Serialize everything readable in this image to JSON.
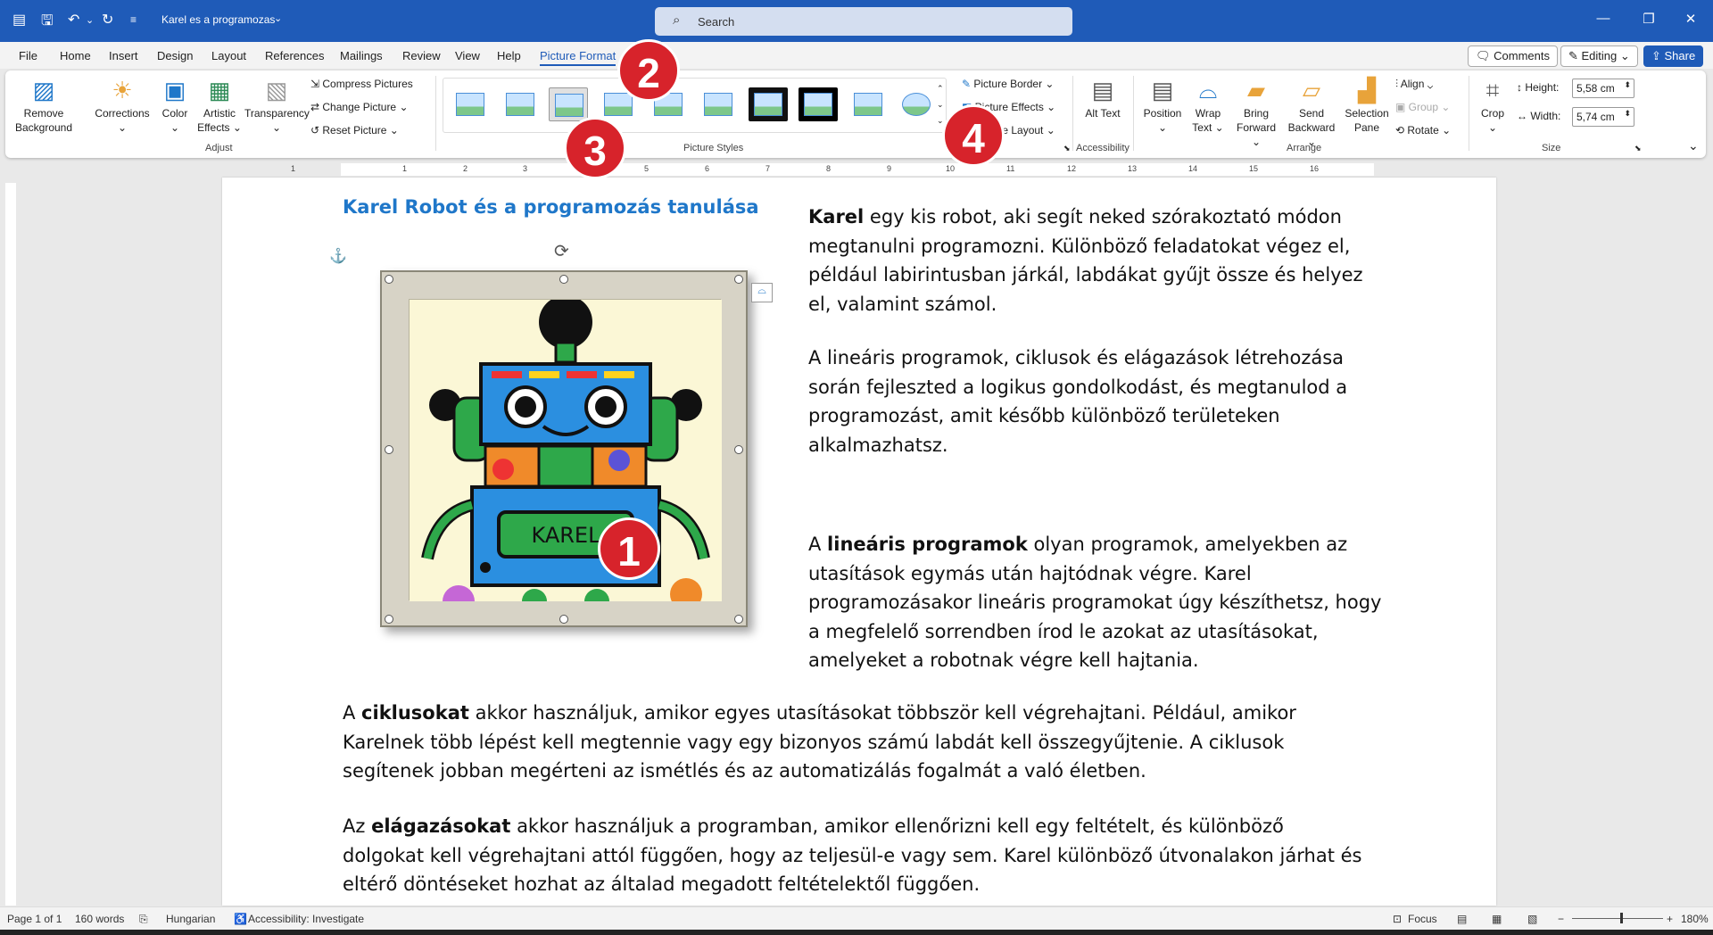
{
  "titlebar": {
    "document_title": "Karel es a programozas",
    "search_placeholder": "Search"
  },
  "tabs": [
    "File",
    "Home",
    "Insert",
    "Design",
    "Layout",
    "References",
    "Mailings",
    "Review",
    "View",
    "Help",
    "Picture Format"
  ],
  "active_tab": "Picture Format",
  "top_buttons": {
    "comments": "Comments",
    "editing": "Editing",
    "share": "Share"
  },
  "ribbon": {
    "adjust": {
      "remove_background": "Remove Background",
      "corrections": "Corrections",
      "color": "Color",
      "artistic_effects": "Artistic Effects",
      "transparency": "Transparency",
      "compress_pictures": "Compress Pictures",
      "change_picture": "Change Picture",
      "reset_picture": "Reset Picture",
      "group_label": "Adjust"
    },
    "picture_styles": {
      "picture_border": "Picture Border",
      "picture_effects": "Picture Effects",
      "picture_layout": "Picture Layout",
      "group_label": "Picture Styles"
    },
    "accessibility": {
      "alt_text": "Alt Text",
      "group_label": "Accessibility"
    },
    "arrange": {
      "position": "Position",
      "wrap_text": "Wrap Text",
      "bring_forward": "Bring Forward",
      "send_backward": "Send Backward",
      "selection_pane": "Selection Pane",
      "align": "Align",
      "group": "Group",
      "rotate": "Rotate",
      "group_label": "Arrange"
    },
    "size": {
      "crop": "Crop",
      "height_label": "Height:",
      "height_value": "5,58 cm",
      "width_label": "Width:",
      "width_value": "5,74 cm",
      "group_label": "Size"
    }
  },
  "ruler_numbers": [
    "1",
    "1",
    "2",
    "3",
    "4",
    "5",
    "6",
    "7",
    "8",
    "9",
    "10",
    "11",
    "12",
    "13",
    "14",
    "15",
    "16"
  ],
  "document": {
    "heading": "Karel Robot és a programozás tanulása",
    "image_label": "KAREL",
    "p1_bold": "Karel",
    "p1_rest": " egy kis robot, aki segít neked szórakoztató módon megtanulni programozni. Különböző feladatokat végez el, például labirintusban járkál, labdákat gyűjt össze és helyez el, valamint számol.",
    "p2": "A lineáris programok, ciklusok és elágazások létrehozása során fejleszted a logikus gondolkodást, és megtanulod a programozást, amit később különböző területeken alkalmazhatsz.",
    "p3_start": "A ",
    "p3_bold": "lineáris programok",
    "p3_rest": " olyan programok, amelyekben az utasítások egymás után hajtódnak végre. Karel programozásakor lineáris programokat úgy készíthetsz, hogy a megfelelő sorrendben írod le azokat az utasításokat, amelyeket a robotnak végre kell hajtania.",
    "p4_start": "A ",
    "p4_bold": "ciklusokat",
    "p4_rest": " akkor használjuk, amikor egyes utasításokat többször kell végrehajtani. Például, amikor Karelnek több lépést kell megtennie vagy egy bizonyos számú labdát kell összegyűjtenie. A ciklusok segítenek jobban megérteni az ismétlés és az automatizálás fogalmát a való életben.",
    "p5_start": "Az ",
    "p5_bold": "elágazásokat",
    "p5_rest": " akkor használjuk a programban, amikor ellenőrizni kell egy feltételt, és különböző dolgokat kell végrehajtani attól függően, hogy az teljesül-e vagy sem. Karel különböző útvonalakon járhat és eltérő döntéseket hozhat az általad megadott feltételektől függően."
  },
  "badges": [
    "1",
    "2",
    "3",
    "4"
  ],
  "statusbar": {
    "page": "Page 1 of 1",
    "words": "160 words",
    "language": "Hungarian",
    "accessibility": "Accessibility: Investigate",
    "focus": "Focus",
    "zoom": "180%"
  },
  "colors": {
    "accent": "#1f5bb8",
    "heading": "#1f77c9",
    "badge": "#d7232b"
  }
}
